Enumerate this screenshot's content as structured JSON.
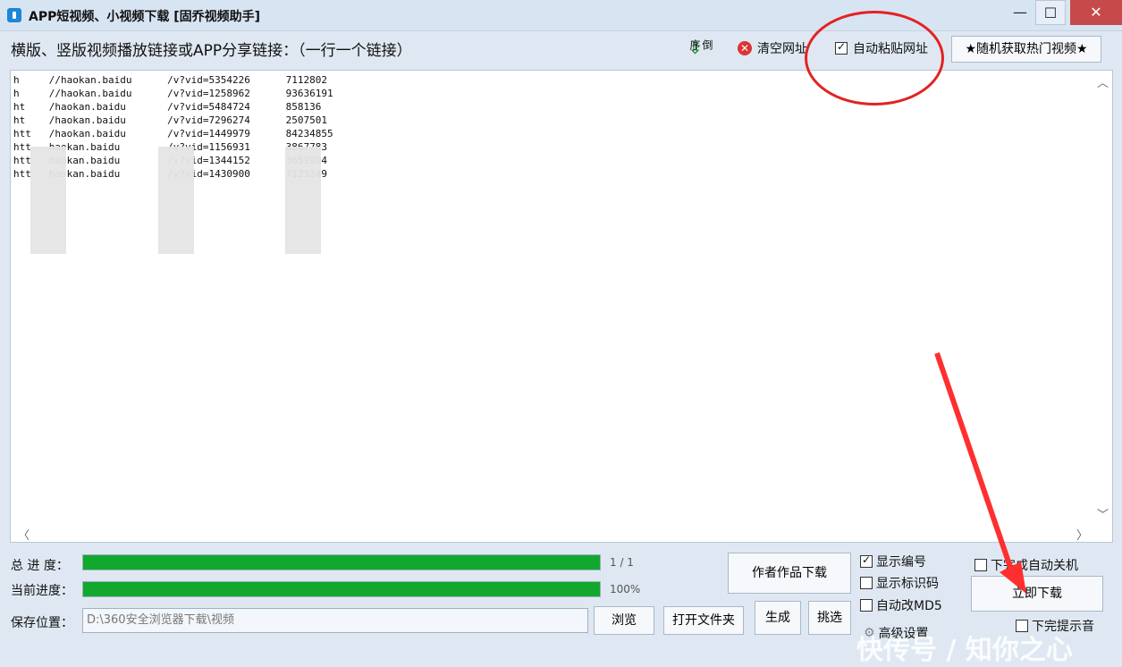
{
  "window": {
    "title": "APP短视频、小视频下载 [固乔视频助手]",
    "min": "—",
    "max": "☐",
    "close": "✕"
  },
  "toolbar": {
    "prompt": "横版、竖版视频播放链接或APP分享链接：（一行一个链接）",
    "reverse_label": "倒序",
    "clear_label": "清空网址",
    "auto_paste_label": "自动粘贴网址",
    "auto_paste_checked": true,
    "hot_video_label": "★随机获取热门视频★"
  },
  "links": [
    "h     //haokan.baidu      /v?vid=5354226      7112802",
    "h     //haokan.baidu      /v?vid=1258962      93636191",
    "ht    /haokan.baidu       /v?vid=5484724      858136",
    "ht    /haokan.baidu       /v?vid=7296274      2507501",
    "htt   /haokan.baidu       /v?vid=1449979      84234855",
    "htt   haokan.baidu        /v?vid=1156931      3867783",
    "htt   haokan.baidu        /v?vid=1344152      3659904",
    "htt   haokan.baidu        /v?vid=1430900      7123249"
  ],
  "progress": {
    "total_label": "总 进 度：",
    "total_value": "1 / 1",
    "total_fraction": 1.0,
    "current_label": "当前进度：",
    "current_value": "100%",
    "current_fraction": 1.0
  },
  "save": {
    "label": "保存位置：",
    "path": "D:\\360安全浏览器下载\\视频",
    "browse": "浏览",
    "open_folder": "打开文件夹",
    "generate": "生成",
    "pick": "挑选"
  },
  "author_download": "作者作品下载",
  "options": {
    "show_index": "显示编号",
    "show_index_checked": true,
    "show_id": "显示标识码",
    "show_id_checked": false,
    "auto_md5": "自动改MD5",
    "auto_md5_checked": false,
    "advanced": "高级设置",
    "auto_shutdown": "下完成自动关机",
    "auto_shutdown_checked": false,
    "download_now": "立即下载",
    "sound_done": "下完提示音",
    "sound_done_checked": false
  },
  "watermark": "快传号 / 知你之心"
}
